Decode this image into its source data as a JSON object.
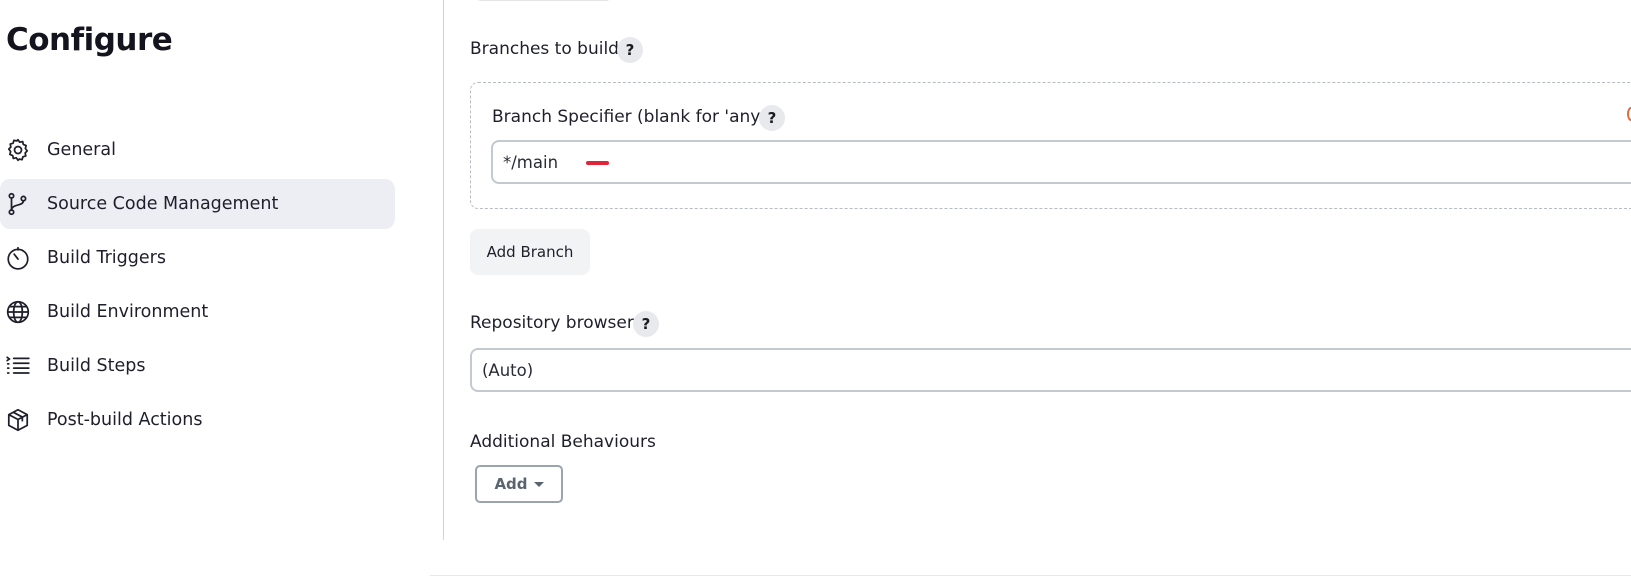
{
  "page": {
    "title": "Configure"
  },
  "sidebar": {
    "items": [
      {
        "label": "General",
        "icon": "gear-icon",
        "active": false
      },
      {
        "label": "Source Code Management",
        "icon": "git-branch-icon",
        "active": true
      },
      {
        "label": "Build Triggers",
        "icon": "timer-icon",
        "active": false
      },
      {
        "label": "Build Environment",
        "icon": "globe-icon",
        "active": false
      },
      {
        "label": "Build Steps",
        "icon": "list-icon",
        "active": false
      },
      {
        "label": "Post-build Actions",
        "icon": "package-icon",
        "active": false
      }
    ]
  },
  "scm": {
    "branches_label": "Branches to build",
    "branch_specifier_label": "Branch Specifier (blank for 'any')",
    "branch_specifier_value": "*/main",
    "add_branch_label": "Add Branch",
    "repo_browser_label": "Repository browser",
    "repo_browser_value": "(Auto)",
    "additional_label": "Additional Behaviours",
    "add_label": "Add",
    "help_glyph": "?"
  },
  "colors": {
    "active_bg": "#eceef3",
    "accent_red": "#e0243a"
  }
}
